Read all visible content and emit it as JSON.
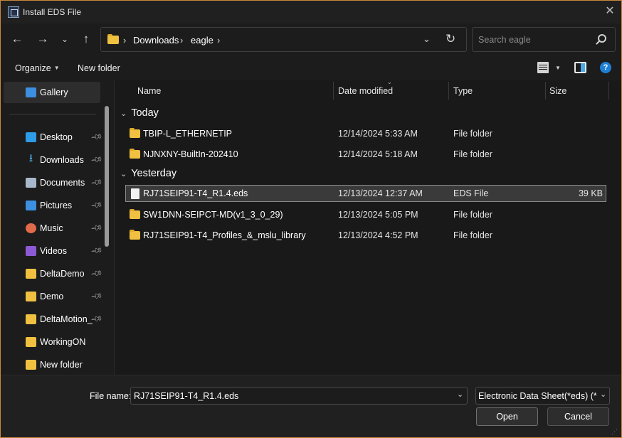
{
  "window": {
    "title": "Install EDS File"
  },
  "nav": {
    "breadcrumb": [
      "Downloads",
      "eagle"
    ],
    "search_placeholder": "Search eagle"
  },
  "toolbar": {
    "organize_label": "Organize",
    "new_folder_label": "New folder"
  },
  "sidebar": {
    "top_items": [
      {
        "label": "Gallery",
        "icon": "gallery-icon",
        "selected": true
      }
    ],
    "items": [
      {
        "label": "Desktop",
        "icon": "desktop-icon",
        "pinned": true
      },
      {
        "label": "Downloads",
        "icon": "download-icon",
        "pinned": true
      },
      {
        "label": "Documents",
        "icon": "documents-icon",
        "pinned": true
      },
      {
        "label": "Pictures",
        "icon": "pictures-icon",
        "pinned": true
      },
      {
        "label": "Music",
        "icon": "music-icon",
        "pinned": true
      },
      {
        "label": "Videos",
        "icon": "videos-icon",
        "pinned": true
      },
      {
        "label": "DeltaDemo",
        "icon": "folder-icon",
        "pinned": true
      },
      {
        "label": "Demo",
        "icon": "folder-icon",
        "pinned": true
      },
      {
        "label": "DeltaMotion_",
        "icon": "folder-icon",
        "pinned": true
      },
      {
        "label": "WorkingON",
        "icon": "folder-icon",
        "pinned": false
      },
      {
        "label": "New folder",
        "icon": "folder-icon",
        "pinned": false
      }
    ]
  },
  "columns": {
    "name": "Name",
    "date": "Date modified",
    "type": "Type",
    "size": "Size"
  },
  "groups": [
    {
      "label": "Today",
      "rows": [
        {
          "name": "TBIP-L_ETHERNETIP",
          "date": "12/14/2024 5:33 AM",
          "type": "File folder",
          "size": "",
          "kind": "folder"
        },
        {
          "name": "NJNXNY-BuiltIn-202410",
          "date": "12/14/2024 5:18 AM",
          "type": "File folder",
          "size": "",
          "kind": "folder"
        }
      ]
    },
    {
      "label": "Yesterday",
      "rows": [
        {
          "name": "RJ71SEIP91-T4_R1.4.eds",
          "date": "12/13/2024 12:37 AM",
          "type": "EDS File",
          "size": "39 KB",
          "kind": "file",
          "selected": true
        },
        {
          "name": "SW1DNN-SEIPCT-MD(v1_3_0_29)",
          "date": "12/13/2024 5:05 PM",
          "type": "File folder",
          "size": "",
          "kind": "folder"
        },
        {
          "name": "RJ71SEIP91-T4_Profiles_&_mslu_library",
          "date": "12/13/2024 4:52 PM",
          "type": "File folder",
          "size": "",
          "kind": "folder"
        }
      ]
    }
  ],
  "footer": {
    "file_name_label": "File name:",
    "file_name_value": "RJ71SEIP91-T4_R1.4.eds",
    "filter_value": "Electronic Data Sheet(*eds) (*.eds)",
    "open_label": "Open",
    "cancel_label": "Cancel"
  },
  "colors": {
    "accent": "#1e7fd6",
    "folder": "#f0c040",
    "window_border": "#c9863a",
    "background": "#1c1c1c"
  }
}
